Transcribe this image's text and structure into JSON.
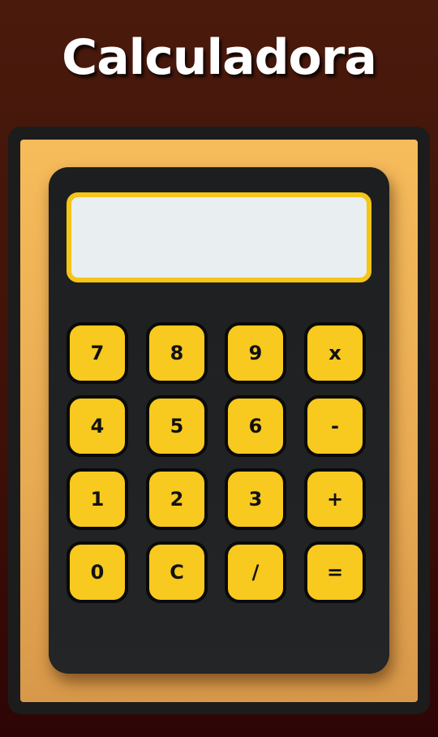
{
  "app": {
    "title": "Calculadora"
  },
  "display": {
    "value": ""
  },
  "keys": {
    "row1": [
      "7",
      "8",
      "9",
      "x"
    ],
    "row2": [
      "4",
      "5",
      "6",
      "-"
    ],
    "row3": [
      "1",
      "2",
      "3",
      "+"
    ],
    "row4": [
      "0",
      "C",
      "/",
      "="
    ]
  },
  "colors": {
    "background": "#4a1a0c",
    "board": "#f6bb5b",
    "calculator_body": "#1d1e20",
    "key": "#f8c91e",
    "screen": "#e9eef0",
    "screen_border": "#f5c518"
  }
}
